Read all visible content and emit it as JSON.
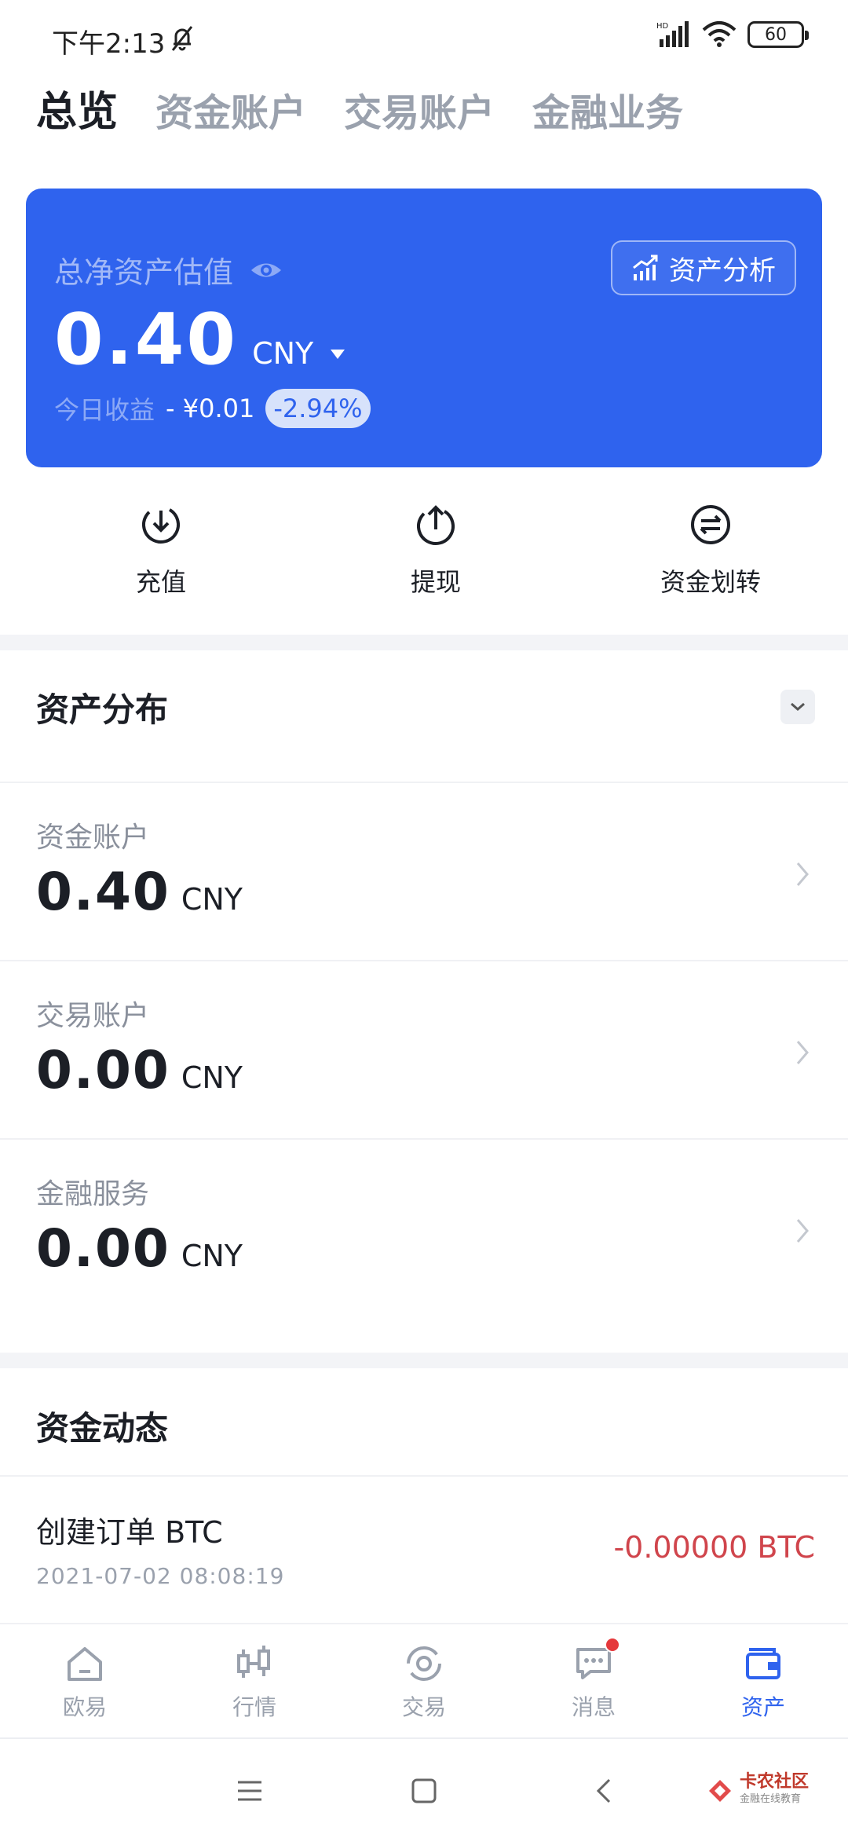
{
  "status_bar": {
    "time": "下午2:13",
    "battery": "60"
  },
  "tabs": [
    {
      "label": "总览",
      "active": true
    },
    {
      "label": "资金账户",
      "active": false
    },
    {
      "label": "交易账户",
      "active": false
    },
    {
      "label": "金融业务",
      "active": false
    }
  ],
  "card": {
    "label": "总净资产估值",
    "analysis_button": "资产分析",
    "value": "0.40",
    "currency": "CNY",
    "pnl_label": "今日收益",
    "pnl_amount": "- ¥0.01",
    "pnl_percent": "-2.94%"
  },
  "actions": [
    {
      "label": "充值",
      "icon": "deposit-icon"
    },
    {
      "label": "提现",
      "icon": "withdraw-icon"
    },
    {
      "label": "资金划转",
      "icon": "transfer-icon"
    }
  ],
  "distribution": {
    "title": "资产分布",
    "accounts": [
      {
        "name": "资金账户",
        "value": "0.40",
        "currency": "CNY"
      },
      {
        "name": "交易账户",
        "value": "0.00",
        "currency": "CNY"
      },
      {
        "name": "金融服务",
        "value": "0.00",
        "currency": "CNY"
      }
    ]
  },
  "activity": {
    "title": "资金动态",
    "items": [
      {
        "title": "创建订单 BTC",
        "time": "2021-07-02 08:08:19",
        "amount": "-0.00000 BTC"
      }
    ]
  },
  "bottom_nav": [
    {
      "label": "欧易",
      "icon": "home-icon",
      "active": false
    },
    {
      "label": "行情",
      "icon": "candlestick-icon",
      "active": false
    },
    {
      "label": "交易",
      "icon": "trade-icon",
      "active": false
    },
    {
      "label": "消息",
      "icon": "message-icon",
      "active": false
    },
    {
      "label": "资产",
      "icon": "wallet-icon",
      "active": true
    }
  ],
  "watermark": {
    "line1": "卡农社区",
    "line2": "金融在线教育"
  },
  "colors": {
    "accent": "#2f63ee",
    "negative": "#d0454c"
  }
}
